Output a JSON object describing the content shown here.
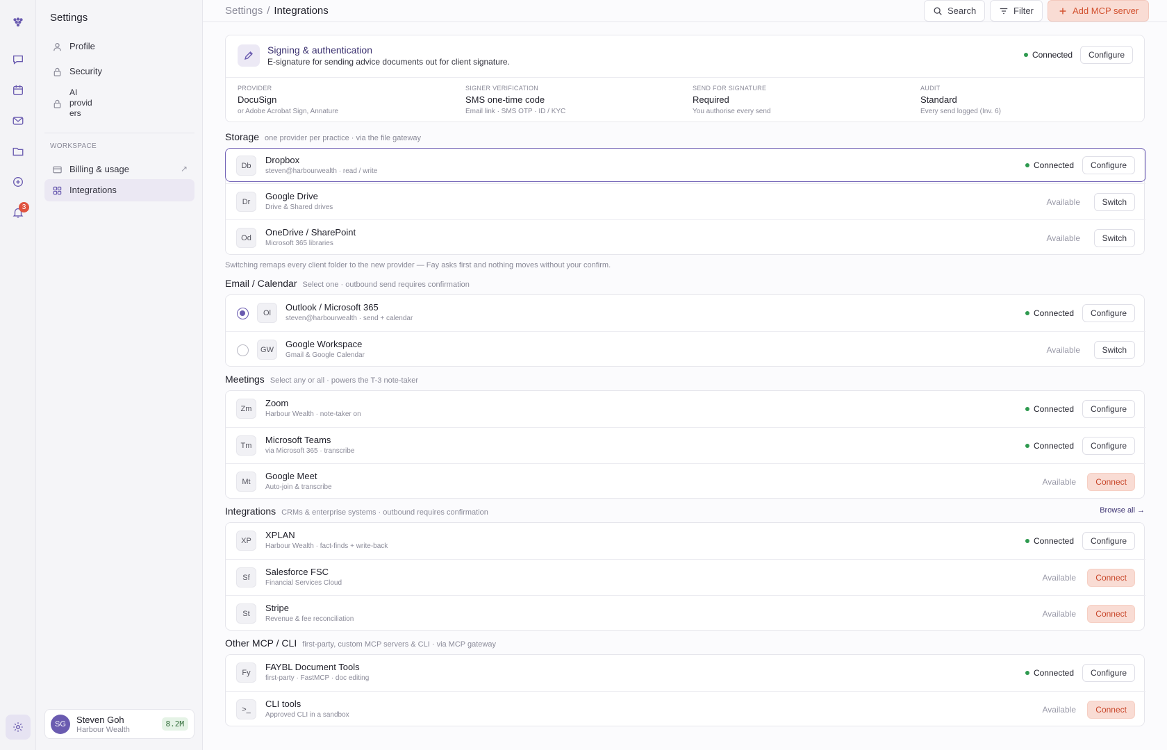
{
  "rail": {
    "notification_count": "3"
  },
  "sidebar": {
    "title": "Settings",
    "items": [
      {
        "label": "Profile"
      },
      {
        "label": "Security"
      },
      {
        "label": "AI\nprovid\ners"
      }
    ],
    "workspace_label": "WORKSPACE",
    "workspace_items": [
      {
        "label": "Billing & usage",
        "external": "↗"
      },
      {
        "label": "Integrations"
      }
    ],
    "user": {
      "initials": "SG",
      "name": "Steven Goh",
      "org": "Harbour Wealth",
      "credits": "8.2M"
    }
  },
  "header": {
    "breadcrumb_root": "Settings",
    "breadcrumb_sep": "/",
    "breadcrumb_current": "Integrations",
    "search_label": "Search",
    "filter_label": "Filter",
    "add_label": "Add MCP server"
  },
  "signing": {
    "title": "Signing & authentication",
    "subtitle": "E-signature for sending advice documents out for client signature.",
    "status": "Connected",
    "action": "Configure",
    "facts": [
      {
        "key": "PROVIDER",
        "value": "DocuSign",
        "sub": "or Adobe Acrobat Sign, Annature"
      },
      {
        "key": "SIGNER VERIFICATION",
        "value": "SMS one-time code",
        "sub": "Email link · SMS OTP · ID / KYC"
      },
      {
        "key": "SEND FOR SIGNATURE",
        "value": "Required",
        "sub": "You authorise every send"
      },
      {
        "key": "AUDIT",
        "value": "Standard",
        "sub": "Every send logged (Inv. 6)"
      }
    ]
  },
  "storage": {
    "title": "Storage",
    "desc": "one provider per practice · via the file gateway",
    "rows": [
      {
        "abbr": "Db",
        "name": "Dropbox",
        "sub": "steven@harbourwealth · read / write",
        "status": "Connected",
        "action": "Configure"
      },
      {
        "abbr": "Dr",
        "name": "Google Drive",
        "sub": "Drive & Shared drives",
        "status": "Available",
        "action": "Switch"
      },
      {
        "abbr": "Od",
        "name": "OneDrive / SharePoint",
        "sub": "Microsoft 365 libraries",
        "status": "Available",
        "action": "Switch"
      }
    ],
    "note": "Switching remaps every client folder to the new provider — Fay asks first and nothing moves without your confirm."
  },
  "email": {
    "title": "Email / Calendar",
    "desc": "Select one · outbound send requires confirmation",
    "rows": [
      {
        "abbr": "Ol",
        "name": "Outlook / Microsoft 365",
        "sub": "steven@harbourwealth · send + calendar",
        "status": "Connected",
        "action": "Configure"
      },
      {
        "abbr": "GW",
        "name": "Google Workspace",
        "sub": "Gmail & Google Calendar",
        "status": "Available",
        "action": "Switch"
      }
    ]
  },
  "meetings": {
    "title": "Meetings",
    "desc": "Select any or all · powers the T-3 note-taker",
    "rows": [
      {
        "abbr": "Zm",
        "name": "Zoom",
        "sub": "Harbour Wealth · note-taker on",
        "status": "Connected",
        "action": "Configure"
      },
      {
        "abbr": "Tm",
        "name": "Microsoft Teams",
        "sub": "via Microsoft 365 · transcribe",
        "status": "Connected",
        "action": "Configure"
      },
      {
        "abbr": "Mt",
        "name": "Google Meet",
        "sub": "Auto-join & transcribe",
        "status": "Available",
        "action": "Connect"
      }
    ]
  },
  "integrations": {
    "title": "Integrations",
    "desc": "CRMs & enterprise systems · outbound requires confirmation",
    "browse": "Browse all →",
    "rows": [
      {
        "abbr": "XP",
        "name": "XPLAN",
        "sub": "Harbour Wealth · fact-finds + write-back",
        "status": "Connected",
        "action": "Configure"
      },
      {
        "abbr": "Sf",
        "name": "Salesforce FSC",
        "sub": "Financial Services Cloud",
        "status": "Available",
        "action": "Connect"
      },
      {
        "abbr": "St",
        "name": "Stripe",
        "sub": "Revenue & fee reconciliation",
        "status": "Available",
        "action": "Connect"
      }
    ]
  },
  "other": {
    "title": "Other MCP / CLI",
    "desc": "first-party, custom MCP servers & CLI · via MCP gateway",
    "rows": [
      {
        "abbr": "Fy",
        "name": "FAYBL Document Tools",
        "sub": "first-party · FastMCP · doc editing",
        "status": "Connected",
        "action": "Configure"
      },
      {
        "abbr": ">_",
        "name": "CLI tools",
        "sub": "Approved CLI in a sandbox",
        "status": "Available",
        "action": "Connect"
      }
    ]
  }
}
